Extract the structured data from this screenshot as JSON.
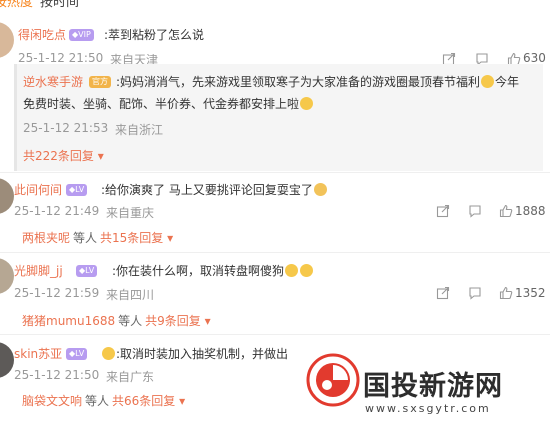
{
  "tabs": [
    "按热度",
    "按时间"
  ],
  "comments": [
    {
      "user": "得闲吃点",
      "text": ":萃到粘粉了怎么说",
      "time": "25-1-12 21:50",
      "location": "来自天津",
      "likes": "630"
    },
    {
      "user": "逆水寒手游",
      "text_line1": ":妈妈消消气，先来游戏里领取寒子为大家准备的游戏圈最顶春节福利",
      "text_line1_end": "今年",
      "text_line2": "免费时装、坐骑、配饰、半价券、代金券都安排上啦",
      "time": "25-1-12 21:53",
      "location": "来自浙江",
      "replies": "共222条回复"
    },
    {
      "user": "此间何间",
      "text": ":给你演爽了 马上又要挑评论回复耍宝了",
      "time": "25-1-12 21:49",
      "location": "来自重庆",
      "likes": "1888",
      "reply_user": "两根夹呢",
      "reply_mid": "等人",
      "replies": "共15条回复"
    },
    {
      "user": "光脚脚_jj",
      "text": ":你在装什么啊，取消转盘啊傻狗",
      "time": "25-1-12 21:59",
      "location": "来自四川",
      "likes": "1352",
      "reply_user": "猪猪mumu1688",
      "reply_mid": "等人",
      "replies": "共9条回复"
    },
    {
      "user": "skin苏亚",
      "text": ":取消时装加入抽奖机制，并做出",
      "time": "25-1-12 21:50",
      "location": "来自广东",
      "reply_user": "脑袋文文响",
      "reply_mid": "等人",
      "replies": "共66条回复"
    }
  ],
  "watermark": {
    "title": "国投新游网",
    "url": "www.sxsgytr.com"
  },
  "colors": {
    "accent": "#eb7350",
    "tab_active": "#f7851f",
    "meta": "#999999"
  }
}
